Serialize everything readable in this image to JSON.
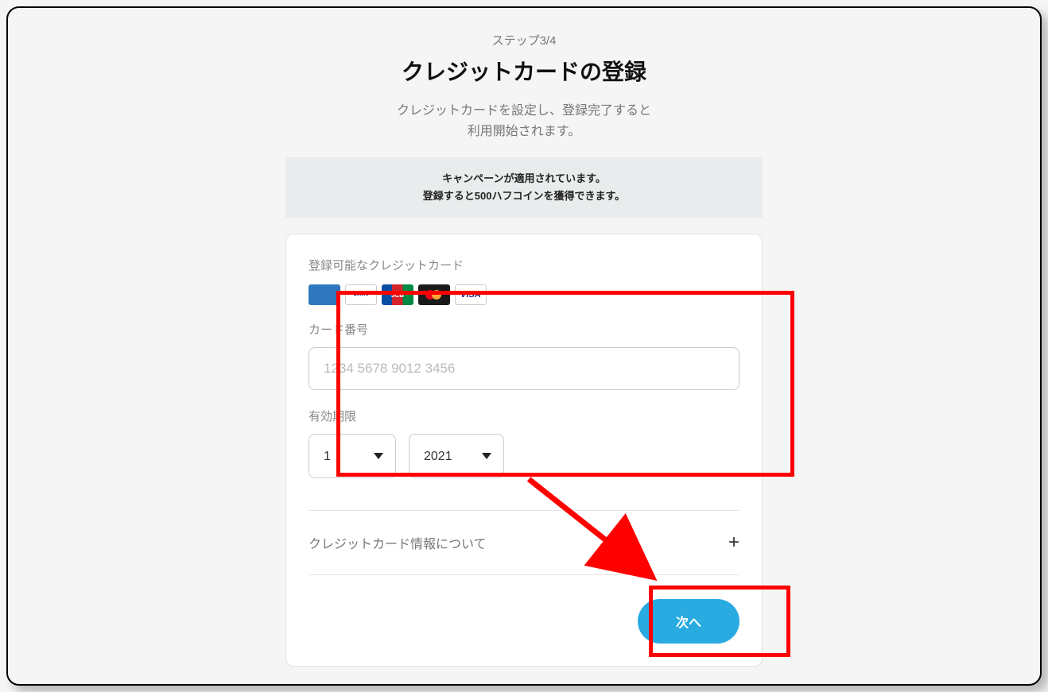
{
  "header": {
    "step": "ステップ3/4",
    "title": "クレジットカードの登録",
    "subtitle_line1": "クレジットカードを設定し、登録完了すると",
    "subtitle_line2": "利用開始されます。"
  },
  "campaign": {
    "line1": "キャンペーンが適用されています。",
    "line2": "登録すると500ハフコインを獲得できます。"
  },
  "form": {
    "accepted_label": "登録可能なクレジットカード",
    "card_brands": [
      "American Express",
      "Diners Club",
      "JCB",
      "Mastercard",
      "VISA"
    ],
    "card_number_label": "カード番号",
    "card_number_placeholder": "1234 5678 9012 3456",
    "card_number_value": "",
    "expiry_label": "有効期限",
    "expiry_month": "1",
    "expiry_year": "2021"
  },
  "accordion": {
    "about_label": "クレジットカード情報について"
  },
  "buttons": {
    "next": "次へ"
  },
  "annotations": {
    "highlight_inputs": true,
    "highlight_next_button": true,
    "arrow_from_inputs_to_button": true
  }
}
